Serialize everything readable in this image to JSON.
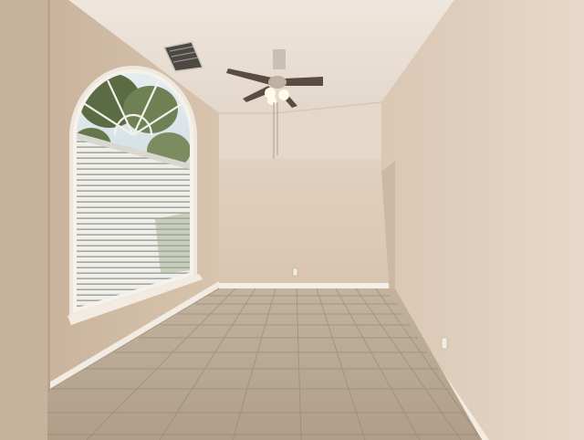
{
  "scene": {
    "subject": "empty-room-interior",
    "icons": [
      "arched-window-icon",
      "window-blinds-icon",
      "ceiling-fan-icon",
      "air-vent-icon",
      "floor-tile-icon",
      "wall-outlet-icon"
    ],
    "colors": {
      "left_wall": "#d2bda6",
      "back_wall": "#dcc8b3",
      "right_wall": "#e2d0bf",
      "ceiling": "#e8ddd2",
      "floor_tile": "#b8a792",
      "grout": "#8e8170",
      "baseboard": "#f4eee6",
      "window_sky": "#c8d6dc",
      "tree_green": "#6f8054"
    }
  }
}
